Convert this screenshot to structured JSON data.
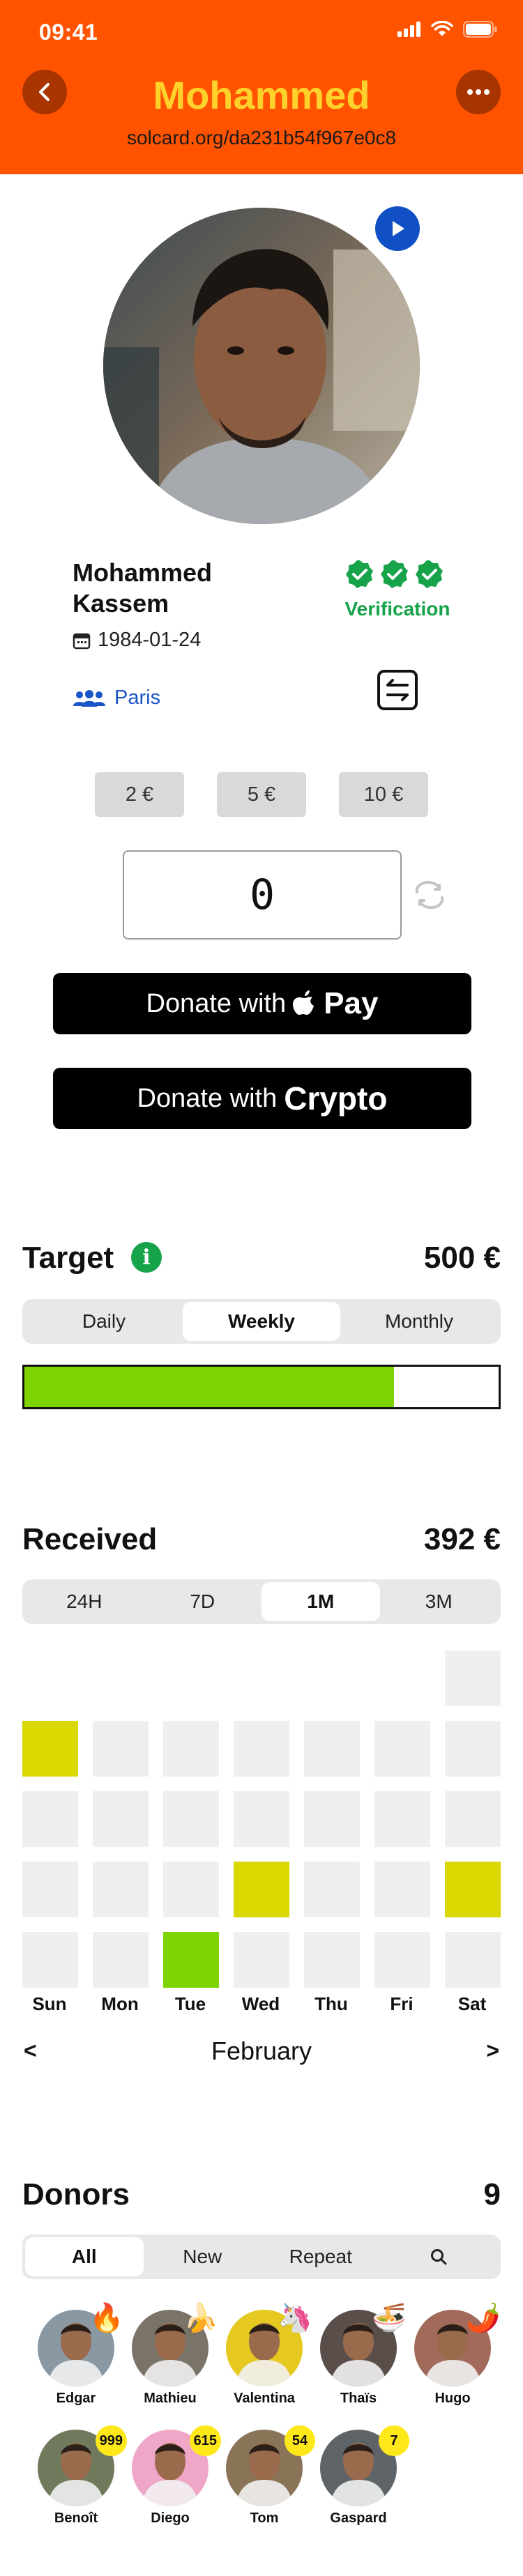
{
  "status": {
    "time": "09:41"
  },
  "header": {
    "title": "Mohammed",
    "url": "solcard.org/da231b54f967e0c8"
  },
  "profile": {
    "name": "Mohammed Kassem",
    "birthdate": "1984-01-24",
    "city": "Paris",
    "verification_label": "Verification",
    "verified_checks": 3
  },
  "donate": {
    "presets": [
      "2 €",
      "5 €",
      "10 €"
    ],
    "amount": "0",
    "apple_prefix": "Donate with",
    "apple_pay": "Pay",
    "crypto_prefix": "Donate with",
    "crypto_word": "Crypto"
  },
  "target": {
    "title": "Target",
    "value": "500 €",
    "tabs": [
      "Daily",
      "Weekly",
      "Monthly"
    ],
    "active_tab": 1,
    "progress_fraction": 0.78,
    "colors": {
      "fill": "#7ED400"
    }
  },
  "received": {
    "title": "Received",
    "value": "392 €",
    "tabs": [
      "24H",
      "7D",
      "1M",
      "3M"
    ],
    "active_tab": 2,
    "days": [
      "Sun",
      "Mon",
      "Tue",
      "Wed",
      "Thu",
      "Fri",
      "Sat"
    ],
    "month": "February",
    "prev": "<",
    "next": ">",
    "colors": {
      "empty": "#EFEFEF",
      "yellow": "#D9D800",
      "green": "#7ED400"
    },
    "grid_rows": [
      [
        null,
        null,
        null,
        null,
        null,
        null,
        "empty"
      ],
      [
        "yellow",
        "empty",
        "empty",
        "empty",
        "empty",
        "empty",
        "empty"
      ],
      [
        "empty",
        "empty",
        "empty",
        "empty",
        "empty",
        "empty",
        "empty"
      ],
      [
        "empty",
        "empty",
        "empty",
        "yellow",
        "empty",
        "empty",
        "yellow"
      ],
      [
        "empty",
        "empty",
        "green",
        "empty",
        "empty",
        "empty",
        "empty"
      ]
    ]
  },
  "donors": {
    "title": "Donors",
    "count": "9",
    "tabs": [
      "All",
      "New",
      "Repeat"
    ],
    "active_tab": 0,
    "search_icon": "search-icon",
    "list": [
      {
        "name": "Edgar",
        "emoji": "🔥",
        "badge": "",
        "bg": "#8a98a4"
      },
      {
        "name": "Mathieu",
        "emoji": "🍌",
        "badge": "",
        "bg": "#7a7468"
      },
      {
        "name": "Valentina",
        "emoji": "🦄",
        "badge": "",
        "bg": "#E5C820"
      },
      {
        "name": "Thaïs",
        "emoji": "🍜",
        "badge": "",
        "bg": "#5a4e4a"
      },
      {
        "name": "Hugo",
        "emoji": "🌶️",
        "badge": "",
        "bg": "#a26a5a"
      },
      {
        "name": "Benoît",
        "emoji": "",
        "badge": "999",
        "bg": "#6f7a5c"
      },
      {
        "name": "Diego",
        "emoji": "",
        "badge": "615",
        "bg": "#F0A6C6"
      },
      {
        "name": "Tom",
        "emoji": "",
        "badge": "54",
        "bg": "#8a7458"
      },
      {
        "name": "Gaspard",
        "emoji": "",
        "badge": "7",
        "bg": "#5f6468"
      }
    ]
  }
}
